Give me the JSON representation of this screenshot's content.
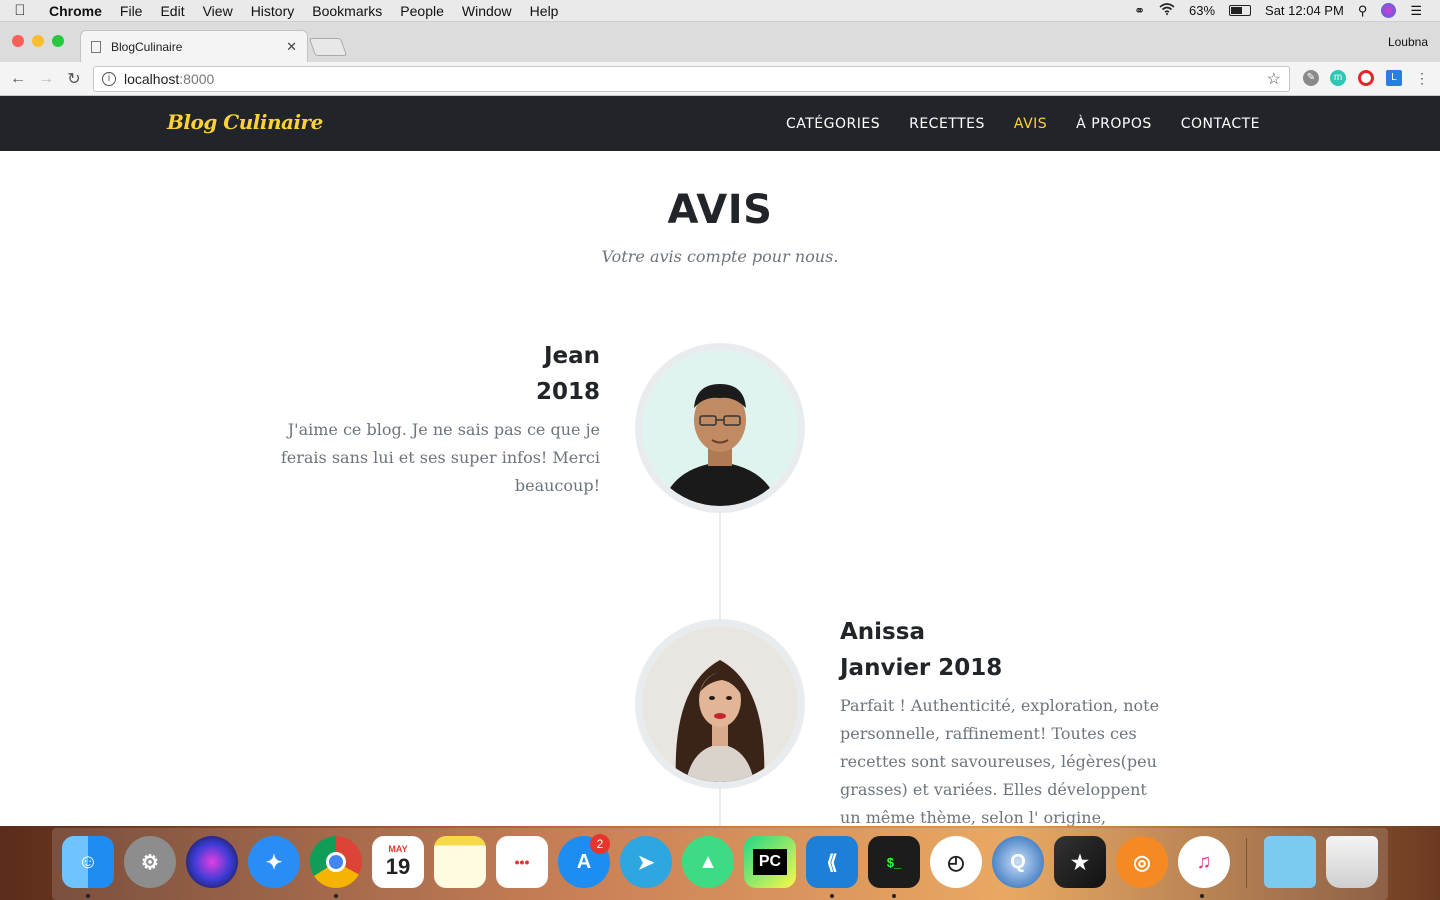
{
  "menubar": {
    "app": "Chrome",
    "items": [
      "File",
      "Edit",
      "View",
      "History",
      "Bookmarks",
      "People",
      "Window",
      "Help"
    ],
    "battery": "63%",
    "battery_level": 0.63,
    "clock": "Sat 12:04 PM"
  },
  "browser": {
    "tab_title": "BlogCulinaire",
    "profile": "Loubna",
    "url_host": "localhost",
    "url_port": ":8000"
  },
  "site": {
    "brand": "Blog Culinaire",
    "nav": [
      "CATÉGORIES",
      "RECETTES",
      "AVIS",
      "À PROPOS",
      "CONTACTE"
    ],
    "active_nav": "AVIS",
    "accent_color": "#fed136"
  },
  "section": {
    "title": "AVIS",
    "subtitle": "Votre avis compte pour nous."
  },
  "reviews": [
    {
      "name": "Jean",
      "date": "2018",
      "text": "J'aime ce blog. Je ne sais pas ce que je ferais sans lui et ses super infos! Merci beaucoup!"
    },
    {
      "name": "Anissa",
      "date": "Janvier 2018",
      "text": "Parfait ! Authenticité, exploration, note personnelle, raffinement! Toutes ces recettes sont savoureuses, légères(peu grasses) et variées. Elles développent un même thème, selon l' origine, remonte le"
    }
  ],
  "dock": {
    "calendar_month": "MAY",
    "calendar_day": "19",
    "appstore_badge": "2",
    "icons": [
      "finder-icon",
      "system-preferences-icon",
      "siri-icon",
      "safari-icon",
      "chrome-icon",
      "calendar-icon",
      "notes-icon",
      "reminders-icon",
      "app-store-icon",
      "telegram-icon",
      "android-studio-icon",
      "pycharm-icon",
      "vscode-icon",
      "terminal-icon",
      "clock-icon",
      "quicktime-icon",
      "final-cut-icon",
      "blender-icon",
      "itunes-icon",
      "folder-icon",
      "trash-icon"
    ]
  }
}
